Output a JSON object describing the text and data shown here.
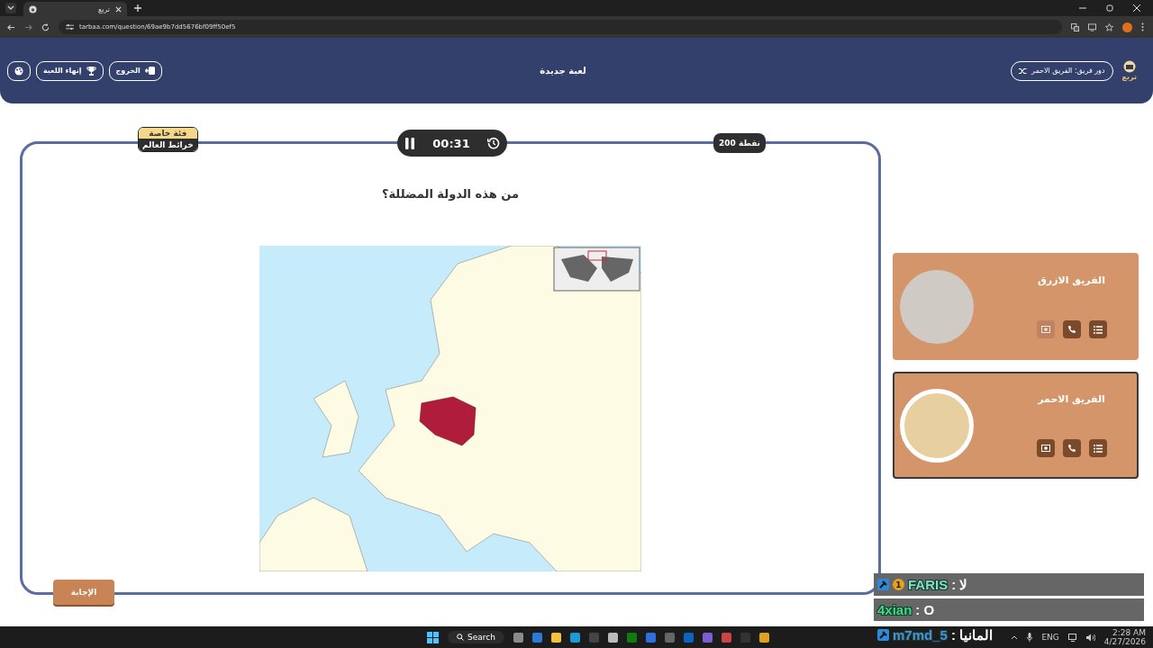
{
  "browser": {
    "tab_title": "تربع",
    "url": "tarbaa.com/question/69ae9b7dd5676bf09ff50ef5"
  },
  "header": {
    "buttons": [
      {
        "kind": "exit",
        "label": "الخروج"
      },
      {
        "kind": "end",
        "label": "إنهاء اللعبة"
      },
      {
        "kind": "theme"
      }
    ],
    "title": "لعبة جديدة",
    "turn": "دور فريق: الفريق الاحمر",
    "logo": "تربع"
  },
  "question": {
    "category_top": "فئة خاصة",
    "category": "خرائط العالم",
    "timer": "00:31",
    "points": "200 نقطة",
    "text": "من هذه الدولة المضللة؟",
    "answer_button": "الإجابة"
  },
  "teams": [
    {
      "name": "الفريق الازرق",
      "selected": false,
      "tools": [
        {
          "kind": "swap",
          "disabled": true
        },
        {
          "kind": "call",
          "disabled": false
        },
        {
          "kind": "list",
          "disabled": false
        }
      ]
    },
    {
      "name": "الفريق الاحمر",
      "selected": true,
      "tools": [
        {
          "kind": "swap",
          "disabled": false
        },
        {
          "kind": "call",
          "disabled": false
        },
        {
          "kind": "list",
          "disabled": false
        }
      ]
    }
  ],
  "chat": [
    {
      "name": "FARIS",
      "color": "#7fe0c4",
      "text": ": لا",
      "pin": true,
      "coin": "1",
      "shaded": true
    },
    {
      "name": "4xian",
      "color": "#3ddc84",
      "text": ": O",
      "pin": false,
      "shaded": true
    },
    {
      "name": "m7md_5",
      "color": "#4a90d9",
      "text": ": المانيا",
      "pin": true,
      "shaded": false
    }
  ],
  "taskbar": {
    "search": "Search",
    "lang": "ENG",
    "time": "2:28 AM",
    "date": "4/27/2026"
  }
}
